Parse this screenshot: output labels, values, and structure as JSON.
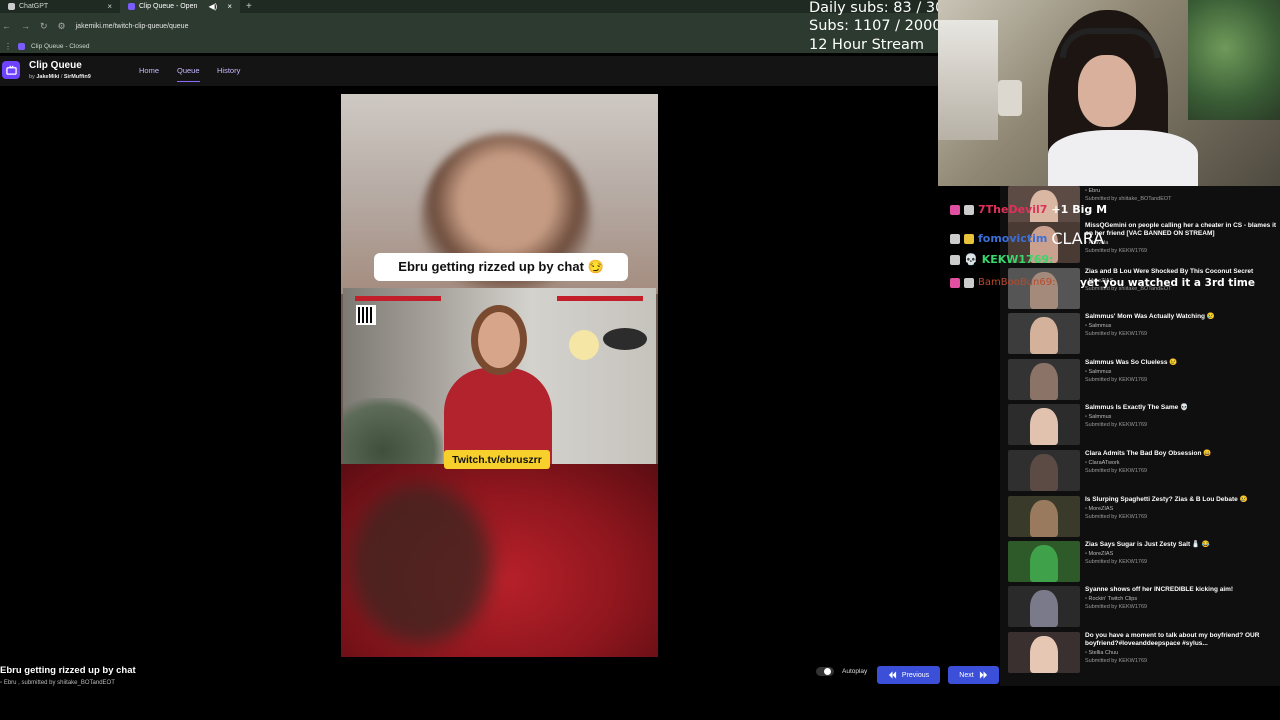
{
  "browser": {
    "tabs": [
      {
        "label": "ChatGPT"
      },
      {
        "label": "Clip Queue - Open"
      }
    ],
    "url": "jakemiki.me/twitch-clip-queue/queue",
    "bookmark": "Clip Queue - Closed"
  },
  "app": {
    "title": "Clip Queue",
    "by_prefix": "by",
    "author1": "JakeMiki",
    "sep": "/",
    "author2": "SirMuffin9",
    "nav": {
      "home": "Home",
      "queue": "Queue",
      "history": "History"
    }
  },
  "player": {
    "caption": "Ebru getting rizzed up by chat 😏",
    "twitch_tag": "Twitch.tv/ebruszrr",
    "clip_title": "Ebru getting rizzed up by chat",
    "clip_meta": "Ebru , submitted by shiitake_BOTandEOT",
    "autoplay_label": "Autoplay",
    "previous_label": "Previous",
    "next_label": "Next"
  },
  "overlay": {
    "daily_subs": "Daily subs: 83 / 30",
    "subs": "Subs: 1107 / 2000",
    "stream": "12 Hour Stream"
  },
  "chat": [
    {
      "name": "7TheDevil7",
      "message": "+1",
      "extra": "Big M",
      "color": "#e0315a"
    },
    {
      "name": "fomovictim",
      "message": "CLARA",
      "color": "#3b6fd8"
    },
    {
      "name": "KEKW1769:",
      "message": "yet you watched it a 3rd time",
      "color": "#38d66b"
    },
    {
      "name": "BamBooBun69:",
      "message": "",
      "color": "#b94a2c"
    }
  ],
  "queue": [
    {
      "title": "",
      "channel": "Ebru",
      "submitted": "Submitted by shiitake_BOTandEOT",
      "thumb": "#5b4b44",
      "fig": "#d9b7a3"
    },
    {
      "title": "MissQGemini on people calling her a cheater in CS - blames it on her friend [VAC BANNED ON STREAM]",
      "channel": "Phavela",
      "submitted": "Submitted by KEKW1769",
      "thumb": "#4a3a34",
      "fig": "#caa08e"
    },
    {
      "title": "Zias and B Lou Were Shocked By This Coconut Secret",
      "channel": "MoreZIAS",
      "submitted": "Submitted by shiitake_BOTandEOT",
      "thumb": "#555",
      "fig": "#a48a7a"
    },
    {
      "title": "Salmmus' Mom Was Actually Watching 😢",
      "channel": "Salmmus",
      "submitted": "Submitted by KEKW1769",
      "thumb": "#3c3c3c",
      "fig": "#d3b19b"
    },
    {
      "title": "Salmmus Was So Clueless 😢",
      "channel": "Salmmus",
      "submitted": "Submitted by KEKW1769",
      "thumb": "#333",
      "fig": "#8b7467"
    },
    {
      "title": "Salmmus Is Exactly The Same 💀",
      "channel": "Salmmus",
      "submitted": "Submitted by KEKW1769",
      "thumb": "#2c2c2c",
      "fig": "#e0c2ae"
    },
    {
      "title": "Clara Admits The Bad Boy Obsession 😄",
      "channel": "ClaraATwork",
      "submitted": "Submitted by KEKW1769",
      "thumb": "#2f2f2f",
      "fig": "#5b4b44"
    },
    {
      "title": "Is Slurping Spaghetti Zesty? Zias & B Lou Debate 😢",
      "channel": "MoreZIAS",
      "submitted": "Submitted by KEKW1769",
      "thumb": "#3a3a2a",
      "fig": "#9a7a5e"
    },
    {
      "title": "Zias Says Sugar is Just Zesty Salt 🧂 😂",
      "channel": "MoreZIAS",
      "submitted": "Submitted by KEKW1769",
      "thumb": "#2e5a2a",
      "fig": "#3fa24a"
    },
    {
      "title": "Syanne shows off her INCREDIBLE kicking aim!",
      "channel": "Rockin' Twitch Clips",
      "submitted": "Submitted by KEKW1769",
      "thumb": "#2a2a2a",
      "fig": "#7a7a8a"
    },
    {
      "title": "Do you have a moment to talk about my boyfriend? OUR boyfriend?#loveanddeepspace #sylus...",
      "channel": "Stellia Chuu",
      "submitted": "Submitted by KEKW1769",
      "thumb": "#3a3030",
      "fig": "#e6c7b4"
    }
  ]
}
